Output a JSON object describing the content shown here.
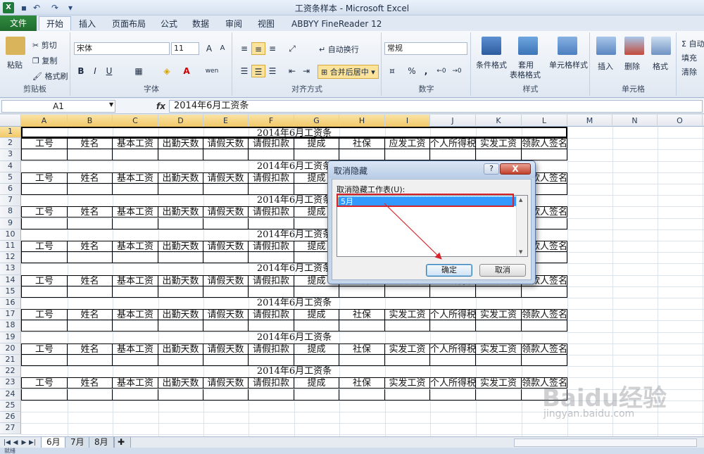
{
  "window": {
    "title": "工资条样本 - Microsoft Excel",
    "app_icon": "X"
  },
  "ribbon_tabs": [
    "文件",
    "开始",
    "插入",
    "页面布局",
    "公式",
    "数据",
    "审阅",
    "视图",
    "ABBYY FineReader 12"
  ],
  "clipboard": {
    "paste": "粘贴",
    "cut": "剪切",
    "copy": "复制",
    "format_painter": "格式刷",
    "group": "剪贴板"
  },
  "font": {
    "name": "宋体",
    "size": "11",
    "bold": "B",
    "italic": "I",
    "underline": "U",
    "group": "字体",
    "grow": "A",
    "shrink": "A",
    "phonetic": "wen"
  },
  "alignment": {
    "wrap": "自动换行",
    "merge": "合并后居中",
    "group": "对齐方式"
  },
  "number": {
    "format": "常规",
    "percent": "%",
    "comma": ",",
    "group": "数字"
  },
  "styles": {
    "conditional": "条件格式",
    "table_format_1": "套用",
    "table_format_2": "表格格式",
    "cell_styles": "单元格样式",
    "group": "样式"
  },
  "cells": {
    "insert": "插入",
    "delete": "删除",
    "format": "格式",
    "group": "单元格"
  },
  "editing": {
    "autosum": "Σ 自动",
    "fill": "填充",
    "clear": "清除"
  },
  "formula_bar": {
    "name_box": "A1",
    "fx": "fx",
    "content": "2014年6月工资条"
  },
  "columns": [
    "A",
    "B",
    "C",
    "D",
    "E",
    "F",
    "G",
    "H",
    "I",
    "J",
    "K",
    "L",
    "M",
    "N",
    "O"
  ],
  "rows": [
    "1",
    "2",
    "3",
    "4",
    "5",
    "6",
    "7",
    "8",
    "9",
    "10",
    "11",
    "12",
    "13",
    "14",
    "15",
    "16",
    "17",
    "18",
    "19",
    "20",
    "21",
    "22",
    "23",
    "24",
    "25",
    "26",
    "27"
  ],
  "sheet": {
    "title": "2014年6月工资条",
    "headers_a": [
      "工号",
      "姓名",
      "基本工资",
      "出勤天数",
      "请假天数",
      "请假扣款",
      "提成",
      "社保",
      "应发工资",
      "个人所得税",
      "实发工资",
      "领款人签名"
    ],
    "headers_b": [
      "工号",
      "姓名",
      "基本工资",
      "出勤天数",
      "请假天数",
      "请假扣款",
      "提成",
      "社保",
      "实发工资",
      "个人所得税",
      "实发工资",
      "领款人签名"
    ]
  },
  "sheet_tabs": [
    "6月",
    "7月",
    "8月"
  ],
  "status": "就绪",
  "watermark": {
    "logo": "Baidu经验",
    "url": "jingyan.baidu.com"
  },
  "dialog": {
    "title": "取消隐藏",
    "help": "?",
    "close": "X",
    "label": "取消隐藏工作表(U):",
    "items": [
      "5月"
    ],
    "ok": "确定",
    "cancel": "取消"
  }
}
